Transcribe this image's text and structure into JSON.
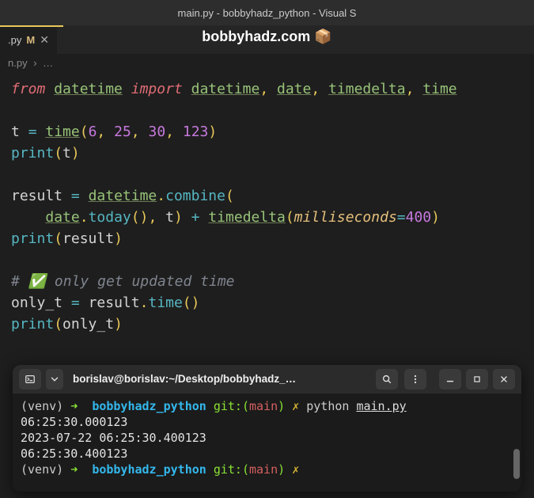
{
  "window_title": "main.py - bobbyhadz_python - Visual S",
  "tab": {
    "filename": ".py",
    "modified_marker": "M"
  },
  "banner": "bobbyhadz.com 📦",
  "breadcrumb": {
    "file": "n.py",
    "sep": "›",
    "rest": "…"
  },
  "code": {
    "l1": {
      "kw1": "from",
      "mod": "datetime",
      "kw2": "import",
      "i1": "datetime",
      "i2": "date",
      "i3": "timedelta",
      "i4": "time"
    },
    "l3": {
      "var": "t",
      "eq": "=",
      "fn": "time",
      "a1": "6",
      "a2": "25",
      "a3": "30",
      "a4": "123"
    },
    "l4": {
      "fn": "print",
      "arg": "t"
    },
    "l6": {
      "var": "result",
      "eq": "=",
      "obj": "datetime",
      "method": "combine"
    },
    "l7": {
      "obj": "date",
      "method": "today",
      "arg2": "t",
      "plus": "+",
      "fn": "timedelta",
      "param": "milliseconds",
      "val": "400"
    },
    "l8": {
      "fn": "print",
      "arg": "result"
    },
    "l10": {
      "comment": "# ✅ only get updated time"
    },
    "l11": {
      "var": "only_t",
      "eq": "=",
      "obj": "result",
      "method": "time"
    },
    "l12": {
      "fn": "print",
      "arg": "only_t"
    }
  },
  "terminal": {
    "title": "borislav@borislav:~/Desktop/bobbyhadz_…",
    "prompt": {
      "venv": "(venv)",
      "arrow": "➜",
      "dir": "bobbyhadz_python",
      "git": "git:(",
      "branch": "main",
      "gitclose": ")",
      "dirty": "✗"
    },
    "cmd": "python",
    "file": "main.py",
    "out1": "06:25:30.000123",
    "out2": "2023-07-22 06:25:30.400123",
    "out3": "06:25:30.400123"
  }
}
